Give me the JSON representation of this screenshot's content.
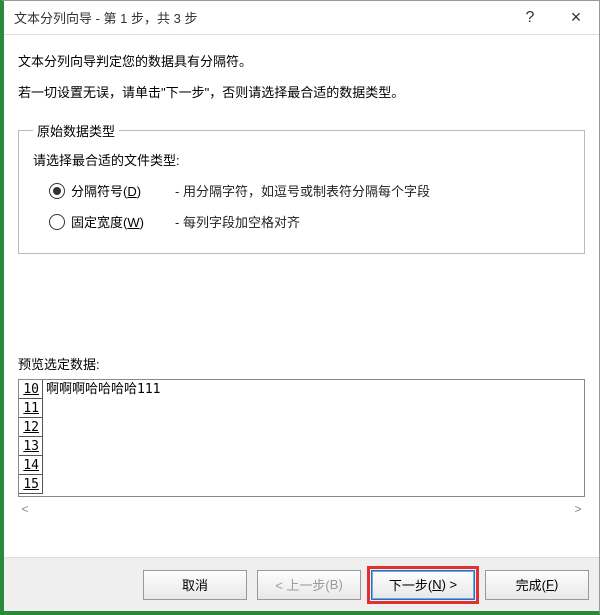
{
  "titlebar": {
    "title": "文本分列向导 - 第 1 步，共 3 步",
    "help_icon": "?",
    "close_icon": "×"
  },
  "intro": {
    "line1": "文本分列向导判定您的数据具有分隔符。",
    "line2": "若一切设置无误，请单击\"下一步\"，否则请选择最合适的数据类型。"
  },
  "group": {
    "legend": "原始数据类型",
    "prompt": "请选择最合适的文件类型:",
    "options": [
      {
        "label_pre": "分隔符号(",
        "hotkey": "D",
        "label_post": ")",
        "desc": "- 用分隔字符，如逗号或制表符分隔每个字段",
        "selected": true
      },
      {
        "label_pre": "固定宽度(",
        "hotkey": "W",
        "label_post": ")",
        "desc": "- 每列字段加空格对齐",
        "selected": false
      }
    ]
  },
  "preview": {
    "label": "预览选定数据:",
    "rows": [
      {
        "num": "10",
        "text": "啊啊啊哈哈哈哈111"
      },
      {
        "num": "11",
        "text": ""
      },
      {
        "num": "12",
        "text": ""
      },
      {
        "num": "13",
        "text": ""
      },
      {
        "num": "14",
        "text": ""
      },
      {
        "num": "15",
        "text": ""
      }
    ],
    "scroll_left": "<",
    "scroll_right": ">"
  },
  "footer": {
    "cancel": "取消",
    "back_pre": "< 上一步(",
    "back_hot": "B",
    "back_post": ")",
    "next_pre": "下一步(",
    "next_hot": "N",
    "next_post": ") >",
    "finish_pre": "完成(",
    "finish_hot": "F",
    "finish_post": ")"
  }
}
